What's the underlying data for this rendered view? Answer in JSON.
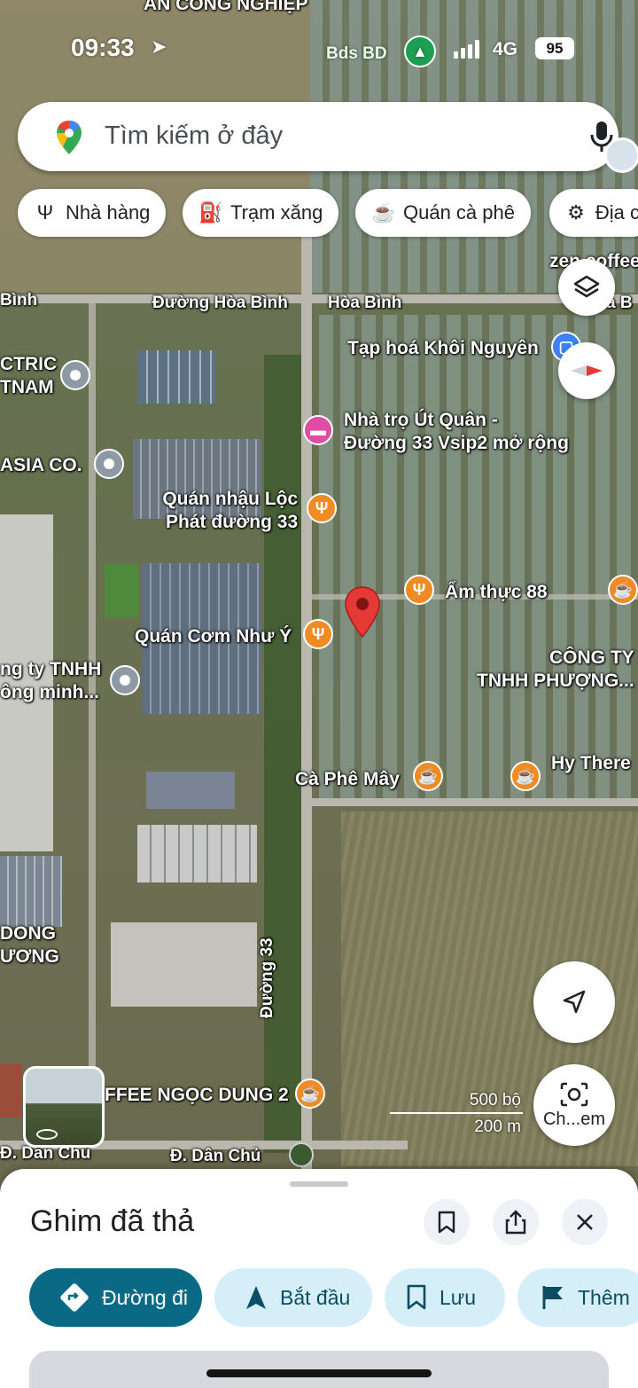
{
  "status_bar": {
    "time": "09:33",
    "hotspot_label": "Bds BD",
    "network": "4G",
    "battery": "95"
  },
  "search": {
    "placeholder": "Tìm kiếm ở đây"
  },
  "chips": [
    {
      "label": "Nhà hàng",
      "icon": "restaurant-icon"
    },
    {
      "label": "Trạm xăng",
      "icon": "gas-station-icon"
    },
    {
      "label": "Quán cà phê",
      "icon": "coffee-icon"
    },
    {
      "label": "Địa c",
      "icon": "attraction-icon"
    }
  ],
  "map": {
    "labels": {
      "top_cut": "ÁN CÔNG NGHIỆP",
      "binh_left": "Bình",
      "duong_hoa_binh": "Đường Hòa Bình",
      "hoa_binh": "Hòa Bình",
      "zen_coffee": "zen coffee",
      "a_b_right": "a B",
      "ctric_1": "CTRIC",
      "ctric_2": "TNAM",
      "tap_hoa": "Tạp hoá Khôi Nguyên",
      "nha_tro_1": "Nhà trọ Út Quân -",
      "nha_tro_2": "Đường 33 Vsip2 mở rộng",
      "asia": "ASIA CO.",
      "quan_nhau_1": "Quán nhậu Lộc",
      "quan_nhau_2": "Phát đường 33",
      "am_thuc": "Ẩm thực 88",
      "quan_com": "Quán Cơm Như Ý",
      "ty_tnhh_1": "ng ty TNHH",
      "ty_tnhh_2": "ông minh...",
      "cong_ty_1": "CÔNG TY",
      "cong_ty_2": "TNHH PHƯỢNG...",
      "hy_there": "Hy There",
      "ca_phe_may": "Cà Phê Mây",
      "dong_1": "DONG",
      "dong_2": "ƯƠNG",
      "duong_33": "Đường 33",
      "coffee_ngoc_dung": "FFEE NGỌC DUNG 2",
      "dan_chu_left": "Đ. Dân Chủ",
      "dan_chu": "Đ. Dân Chủ"
    },
    "scale_top": "500 bộ",
    "scale_bottom": "200 m",
    "lens_label": "Ch...em"
  },
  "sheet": {
    "title": "Ghim đã thả",
    "actions": [
      {
        "label": "Đường đi",
        "icon": "directions-icon"
      },
      {
        "label": "Bắt đầu",
        "icon": "navigation-arrow-icon"
      },
      {
        "label": "Lưu",
        "icon": "bookmark-icon"
      },
      {
        "label": "Thêm",
        "icon": "flag-icon"
      }
    ]
  },
  "colors": {
    "primary_action": "#0a6a86",
    "secondary_action": "#d5eef7",
    "pin_red": "#e53935",
    "poi_orange": "#f08a23"
  }
}
